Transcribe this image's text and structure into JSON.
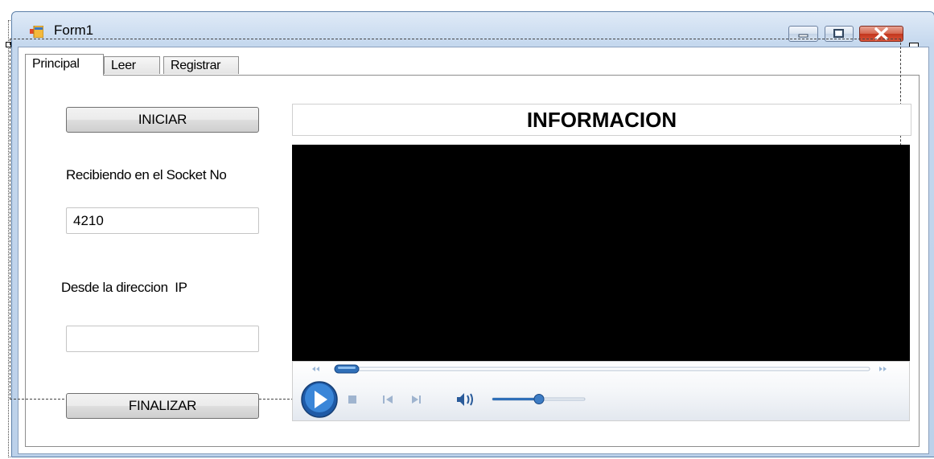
{
  "window": {
    "title": "Form1"
  },
  "tabs": [
    {
      "label": "Principal"
    },
    {
      "label": "Leer"
    },
    {
      "label": "Registrar"
    }
  ],
  "main": {
    "start_button": "INICIAR",
    "socket_label": "Recibiendo en el Socket No",
    "socket_value": "4210",
    "ip_label": "Desde la direccion  IP",
    "ip_value": "",
    "stop_button": "FINALIZAR",
    "info_title": "INFORMACION"
  },
  "player": {
    "seek_progress": 0.0,
    "volume_level": 0.5,
    "icons": [
      "rewind-icon",
      "fast-forward-icon",
      "play-icon",
      "stop-icon",
      "previous-icon",
      "next-icon",
      "volume-icon"
    ]
  },
  "colors": {
    "titlebar": "#c5d8ee",
    "close_button": "#c3361d",
    "video_background": "#000000"
  }
}
